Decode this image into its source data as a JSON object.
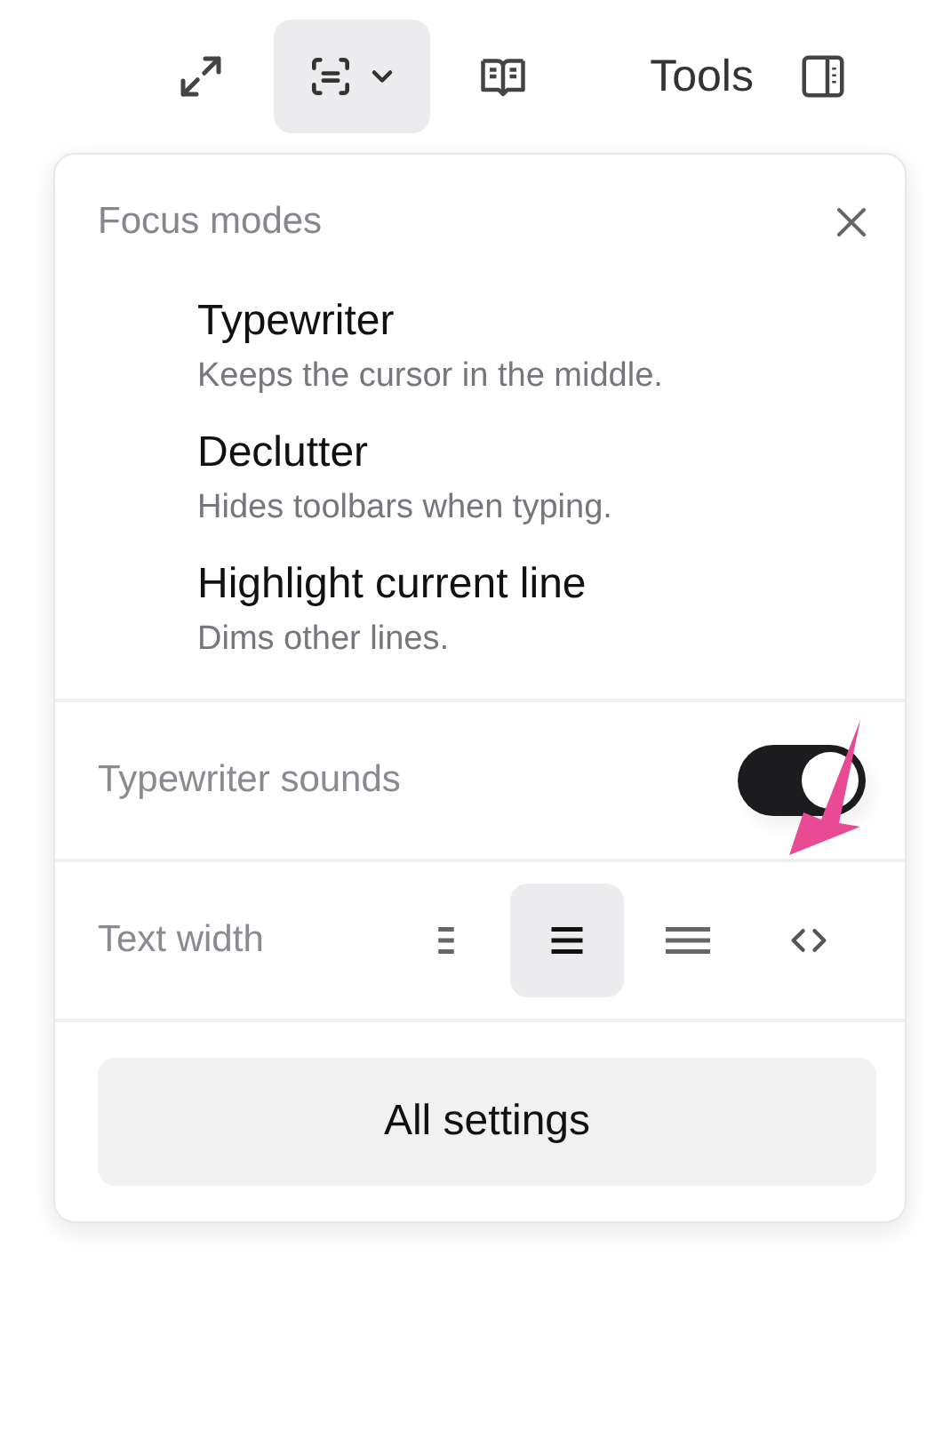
{
  "toolbar": {
    "focus_button": {
      "active": true
    },
    "tools_label": "Tools"
  },
  "panel": {
    "title": "Focus modes",
    "modes": [
      {
        "title": "Typewriter",
        "description": "Keeps the cursor in the middle."
      },
      {
        "title": "Declutter",
        "description": "Hides toolbars when typing."
      },
      {
        "title": "Highlight current line",
        "description": "Dims other lines."
      }
    ],
    "sounds": {
      "label": "Typewriter sounds",
      "on": true
    },
    "text_width": {
      "label": "Text width",
      "options": [
        {
          "kind": "narrow",
          "selected": false
        },
        {
          "kind": "medium",
          "selected": true
        },
        {
          "kind": "wide",
          "selected": false
        },
        {
          "kind": "full",
          "selected": false
        }
      ]
    },
    "settings_button": "All settings"
  }
}
